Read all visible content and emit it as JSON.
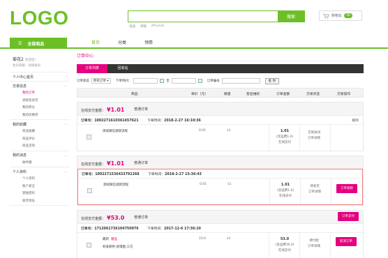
{
  "header": {
    "logo": "LOGO",
    "search_btn": "搜索",
    "hot": [
      "电器",
      "保暖",
      "iPhone6"
    ],
    "cart_label": "购物车",
    "cart_count": "30"
  },
  "nav": {
    "all": "全部商品",
    "tabs": [
      "首页",
      "分类",
      "领券"
    ]
  },
  "side": {
    "user_name": "菊花2",
    "user_welcome": "欢迎您！",
    "user_level": "会员等级：初级会员",
    "sections": [
      {
        "title": "个人中心首页",
        "items": []
      },
      {
        "title": "交易信息",
        "items": [
          "我的订单",
          "退款及退货",
          "我的积分",
          "我的优惠券"
        ]
      },
      {
        "title": "我的收藏",
        "items": [
          "商品收藏",
          "商品评价",
          "商品咨询"
        ]
      },
      {
        "title": "我的消息",
        "items": [
          "收件箱"
        ]
      },
      {
        "title": "个人资料",
        "items": [
          "个人资料",
          "账户安全",
          "登陆密码",
          "收货地址"
        ]
      }
    ]
  },
  "main": {
    "title": "订单中心",
    "tabs": [
      "订单列表",
      "回收站"
    ],
    "filter": {
      "status_label": "订单状态",
      "status_value": "所有订单",
      "time_label": "下单时间：",
      "to": "至",
      "no_label": "订单编号",
      "search": "查 询"
    },
    "columns": [
      "商品",
      "单价（元）",
      "数量",
      "售后维权",
      "订单金额",
      "交易状态",
      "交易操作"
    ],
    "groups": [
      {
        "pay_label": "在线支付金额：",
        "pay_amount": "¥1.01",
        "pay_type": "普通订单",
        "order_no": "订单号：1002271610361657621",
        "order_time_label": "下单时间：",
        "order_time": "2018-2-27 16:10:36",
        "delete": "删除",
        "product": "测试微信退款流程",
        "price": "0.01",
        "qty": "x1",
        "total": "1.01",
        "shipping": "(含运费1.0)",
        "paytype": "在线支付",
        "status1": "交易关闭",
        "status2": "订单详情"
      },
      {
        "pay_label": "在线支付金额：",
        "pay_amount": "¥1.01",
        "pay_type": "普通订单",
        "order_no": "订单号：1002271536433792268",
        "order_time_label": "下单时间：",
        "order_time": "2018-2-27 15:36:43",
        "product": "测试微信退款流程",
        "price": "0.01",
        "qty": "x1",
        "total": "1.01",
        "shipping": "(含运费1.0)",
        "paytype": "在线支付",
        "status1": "待发货",
        "status2": "订单详情",
        "action": "订单退款"
      },
      {
        "pay_label": "在线支付金额：",
        "pay_amount": "¥53.0",
        "pay_type": "普通订单",
        "order_no": "订单号：1712061736104750976",
        "order_time_label": "下单时间：",
        "order_time": "2017-12-6 17:36:10",
        "action_top": "订单支付",
        "product": "最新",
        "product_tag": "赠品",
        "product2": "机身颜色-玫瑰金;三方",
        "price": "23.0",
        "qty": "x1",
        "total": "53.0",
        "shipping": "(含运费30.0)",
        "paytype": "在线支付",
        "status1": "待付款",
        "status2": "订单详情",
        "action": "取消订单"
      }
    ]
  }
}
